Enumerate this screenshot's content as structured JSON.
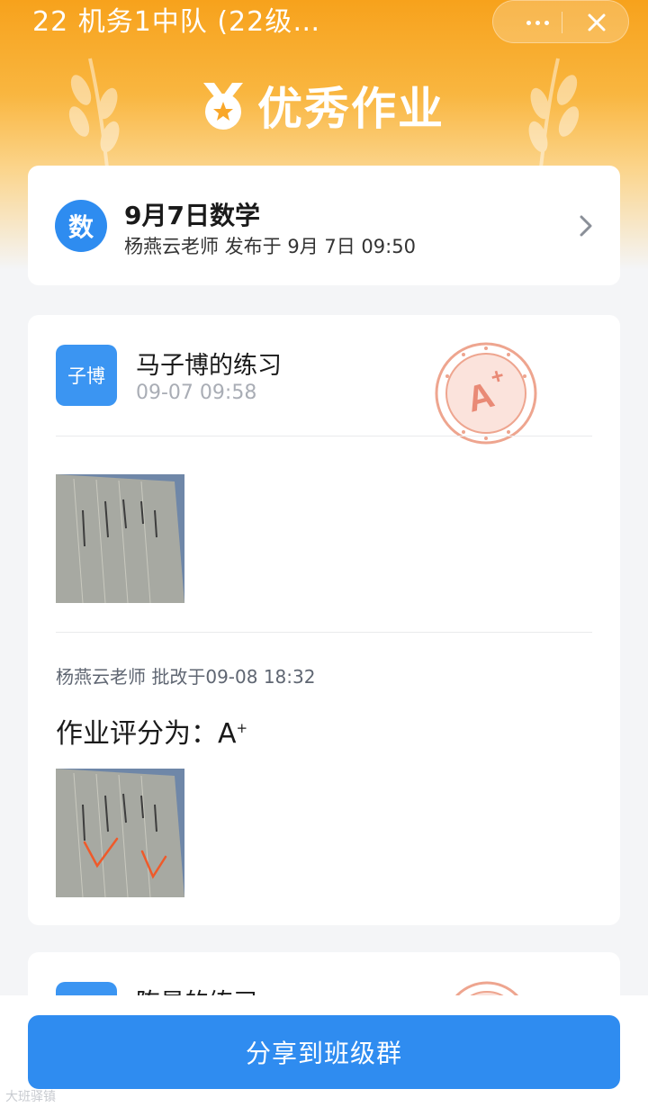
{
  "window": {
    "title": "22 机务1中队 (22级…",
    "more_icon": "more-dots-icon",
    "close_icon": "close-icon"
  },
  "banner": {
    "icon": "medal-star-icon",
    "title": "优秀作业"
  },
  "homework": {
    "subject_badge": "数",
    "title": "9月7日数学",
    "meta": "杨燕云老师 发布于 9月 7日 09:50",
    "chevron_icon": "chevron-right-icon"
  },
  "submissions": [
    {
      "avatar": "子博",
      "name": "马子博的练习",
      "time": "09-07 09:58",
      "stamp": "A+",
      "photo_icon": "homework-photo",
      "grade_meta_prefix": "杨燕云老师 批改于",
      "grade_meta_time": "09-08 18:32",
      "grade_label": "作业评分为：",
      "grade_value": "A",
      "grade_sup": "+",
      "corrected_photo_icon": "corrected-homework-photo"
    },
    {
      "name": "陈昊的练习"
    }
  ],
  "footer": {
    "share_label": "分享到班级群",
    "watermark": "大班驿镇"
  },
  "colors": {
    "accent": "#2f8cf0",
    "banner": "#f7a21c",
    "stamp": "#e98a76"
  }
}
